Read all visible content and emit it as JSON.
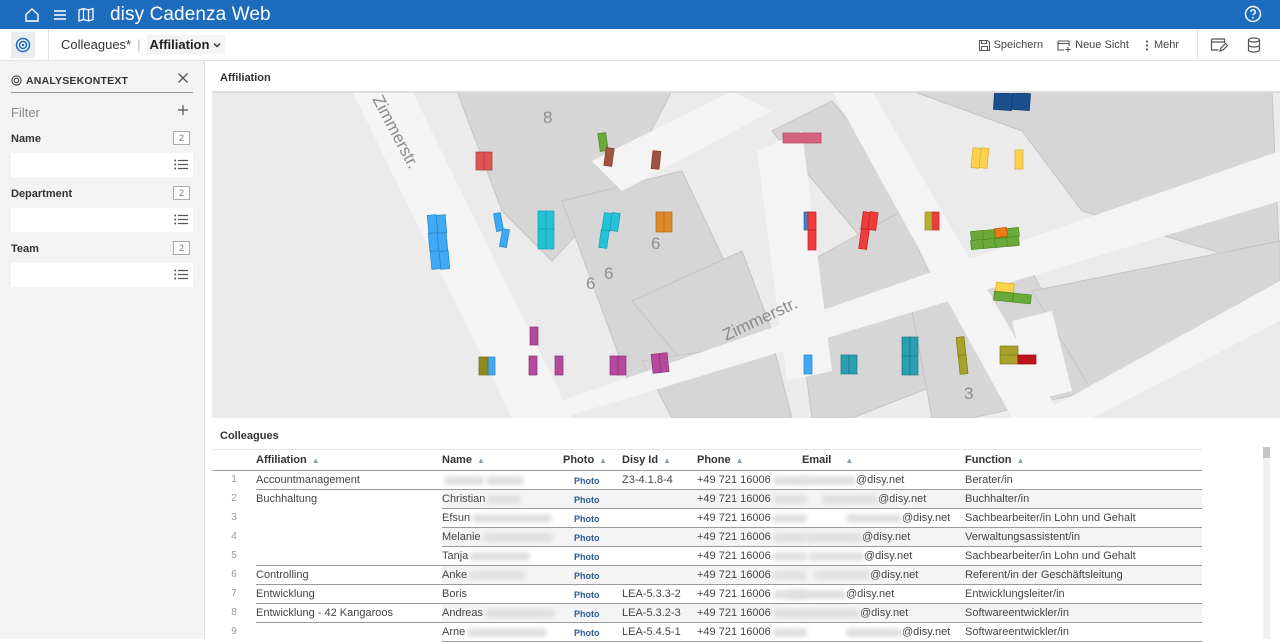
{
  "app": {
    "title": "disy Cadenza Web",
    "colors": {
      "brand": "#1e6cbd",
      "link": "#2c5c95"
    }
  },
  "topbar": {
    "icons": [
      "home-icon",
      "menu-icon",
      "map-icon",
      "help-icon"
    ]
  },
  "breadcrumb": {
    "parent": "Colleagues*",
    "current": "Affiliation"
  },
  "toolbar": {
    "save_label": "Speichern",
    "new_view_label": "Neue Sicht",
    "more_label": "Mehr"
  },
  "sidebar": {
    "title": "ANALYSEKONTEXT",
    "filter_label": "Filter",
    "filters": [
      {
        "label": "Name",
        "count": "2",
        "value": ""
      },
      {
        "label": "Department",
        "count": "2",
        "value": ""
      },
      {
        "label": "Team",
        "count": "2",
        "value": ""
      }
    ]
  },
  "map": {
    "title": "Affiliation",
    "street_labels": [
      "Zimmerstr.",
      "Zimmerstr."
    ],
    "house_numbers": [
      "8",
      "6",
      "6",
      "6",
      "3"
    ]
  },
  "table": {
    "title": "Colleagues",
    "columns": [
      "Affiliation",
      "Name",
      "Photo",
      "Disy Id",
      "Phone",
      "Email",
      "Function"
    ],
    "rows": [
      {
        "num": "1",
        "affiliation": "Accountmanagement",
        "name": "",
        "photo": "Photo",
        "disy_id": "Z3-4.1.8-4",
        "phone": "+49 721 16006",
        "email": "@disy.net",
        "function": "Berater/in"
      },
      {
        "num": "2",
        "affiliation": "Buchhaltung",
        "name": "Christian",
        "photo": "Photo",
        "disy_id": "",
        "phone": "+49 721 16006",
        "email": "@disy.net",
        "function": "Buchhalter/in"
      },
      {
        "num": "3",
        "affiliation": "",
        "name": "Efsun",
        "photo": "Photo",
        "disy_id": "",
        "phone": "+49 721 16006",
        "email": "@disy.net",
        "function": "Sachbearbeiter/in Lohn und Gehalt"
      },
      {
        "num": "4",
        "affiliation": "",
        "name": "Melanie",
        "photo": "Photo",
        "disy_id": "",
        "phone": "+49 721 16006",
        "email": "@disy.net",
        "function": "Verwaltungsassistent/in"
      },
      {
        "num": "5",
        "affiliation": "",
        "name": "Tanja",
        "photo": "Photo",
        "disy_id": "",
        "phone": "+49 721 16006",
        "email": "@disy.net",
        "function": "Sachbearbeiter/in Lohn und Gehalt"
      },
      {
        "num": "6",
        "affiliation": "Controlling",
        "name": "Anke",
        "photo": "Photo",
        "disy_id": "",
        "phone": "+49 721 16006",
        "email": "@disy.net",
        "function": "Referent/in der Geschäftsleitung"
      },
      {
        "num": "7",
        "affiliation": "Entwicklung",
        "name": "Boris",
        "photo": "Photo",
        "disy_id": "LEA-5.3.3-2",
        "phone": "+49 721 16006",
        "email": "@disy.net",
        "function": "Entwicklungsleiter/in"
      },
      {
        "num": "8",
        "affiliation": "Entwicklung - 42 Kangaroos",
        "name": "Andreas",
        "photo": "Photo",
        "disy_id": "LEA-5.3.2-3",
        "phone": "+49 721 16006",
        "email": "@disy.net",
        "function": "Softwareentwickler/in"
      },
      {
        "num": "9",
        "affiliation": "",
        "name": "Arne",
        "photo": "Photo",
        "disy_id": "LEA-5.4.5-1",
        "phone": "+49 721 16006",
        "email": "@disy.net",
        "function": "Softwareentwickler/in"
      }
    ]
  }
}
